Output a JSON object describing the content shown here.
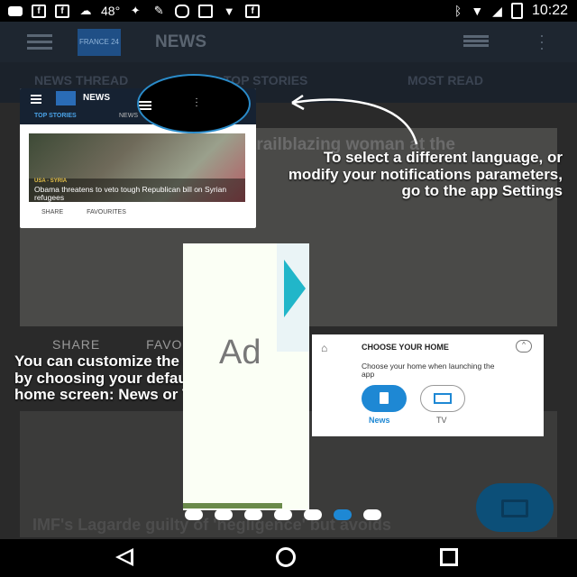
{
  "status_bar": {
    "temperature": "48°",
    "time": "10:22",
    "icons": [
      "message-icon",
      "facebook-icon",
      "facebook-icon",
      "weather-icon",
      "figure-icon",
      "wrench-icon",
      "mask-icon",
      "game-icon",
      "fox-icon",
      "facebook-icon",
      "bluetooth-icon",
      "wifi-icon",
      "signal-icon",
      "battery-icon"
    ]
  },
  "app": {
    "title": "NEWS",
    "logo_text": "FRANCE 24",
    "tabs": [
      "NEWS THREAD",
      "TOP STORIES",
      "MOST READ"
    ],
    "feature_title": "trailblazing woman at the",
    "feature_actions": [
      "SHARE",
      "FAVOURITES"
    ],
    "bottom_headline": "IMF's Lagarde guilty of 'negligence' but avoids"
  },
  "mini": {
    "title": "NEWS",
    "tab_top": "TOP STORIES",
    "tab_news": "NEWS",
    "tag": "USA - SYRIA",
    "headline": "Obama threatens to veto tough Republican bill on Syrian refugees",
    "share": "SHARE",
    "favourites": "FAVOURITES"
  },
  "tips": {
    "settings": "To select a different language, or modify your notifications parameters, go to the app Settings",
    "home": "You can customize the app by choosing your default home screen: News or TV"
  },
  "ad": {
    "label": "Ad"
  },
  "home_card": {
    "title": "CHOOSE YOUR HOME",
    "description": "Choose your home when launching the app",
    "options": [
      "News",
      "TV"
    ],
    "selected": "News"
  },
  "pager": {
    "count": 7,
    "active": 5
  },
  "colors": {
    "accent": "#1e88d4",
    "ad_play": "#21b6c9"
  }
}
